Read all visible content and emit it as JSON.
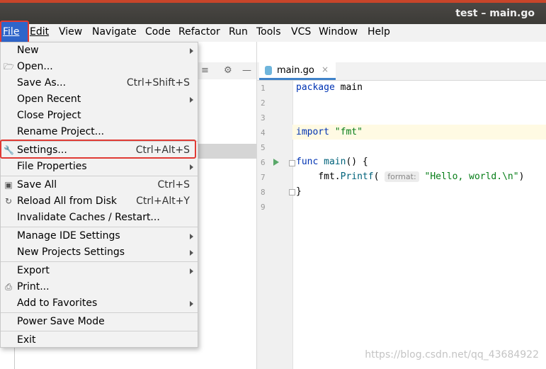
{
  "window": {
    "title": "test – main.go"
  },
  "menubar": {
    "items": [
      "File",
      "Edit",
      "View",
      "Navigate",
      "Code",
      "Refactor",
      "Run",
      "Tools",
      "VCS",
      "Window",
      "Help"
    ]
  },
  "file_menu": {
    "items": [
      {
        "label": "New",
        "shortcut": "",
        "submenu": true,
        "icon": ""
      },
      {
        "label": "Open...",
        "shortcut": "",
        "submenu": false,
        "icon": "folder-icon"
      },
      {
        "label": "Save As...",
        "shortcut": "Ctrl+Shift+S",
        "submenu": false,
        "icon": ""
      },
      {
        "label": "Open Recent",
        "shortcut": "",
        "submenu": true,
        "icon": ""
      },
      {
        "label": "Close Project",
        "shortcut": "",
        "submenu": false,
        "icon": ""
      },
      {
        "label": "Rename Project...",
        "shortcut": "",
        "submenu": false,
        "icon": ""
      },
      {
        "label": "Settings...",
        "shortcut": "Ctrl+Alt+S",
        "submenu": false,
        "icon": "wrench-icon"
      },
      {
        "label": "File Properties",
        "shortcut": "",
        "submenu": true,
        "icon": ""
      },
      {
        "label": "Save All",
        "shortcut": "Ctrl+S",
        "submenu": false,
        "icon": "save-icon"
      },
      {
        "label": "Reload All from Disk",
        "shortcut": "Ctrl+Alt+Y",
        "submenu": false,
        "icon": "reload-icon"
      },
      {
        "label": "Invalidate Caches / Restart...",
        "shortcut": "",
        "submenu": false,
        "icon": ""
      },
      {
        "label": "Manage IDE Settings",
        "shortcut": "",
        "submenu": true,
        "icon": ""
      },
      {
        "label": "New Projects Settings",
        "shortcut": "",
        "submenu": true,
        "icon": ""
      },
      {
        "label": "Export",
        "shortcut": "",
        "submenu": true,
        "icon": ""
      },
      {
        "label": "Print...",
        "shortcut": "",
        "submenu": false,
        "icon": "print-icon"
      },
      {
        "label": "Add to Favorites",
        "shortcut": "",
        "submenu": true,
        "icon": ""
      },
      {
        "label": "Power Save Mode",
        "shortcut": "",
        "submenu": false,
        "icon": ""
      },
      {
        "label": "Exit",
        "shortcut": "",
        "submenu": false,
        "icon": ""
      }
    ]
  },
  "editor": {
    "tab": "main.go",
    "line_numbers": [
      "1",
      "2",
      "3",
      "4",
      "5",
      "6",
      "7",
      "8",
      "9"
    ],
    "code": {
      "line1_kw": "package",
      "line1_rest": " main",
      "line4_kw": "import",
      "line4_str": "\"fmt\"",
      "line6_kw": "func",
      "line6_fn": " main",
      "line6_rest": "() {",
      "line7_pre": "    fmt.",
      "line7_fn": "Printf",
      "line7_paren": "(",
      "line7_hint": "format:",
      "line7_str": "\"Hello, world.\\n\"",
      "line7_close": ")",
      "line8": "}"
    }
  },
  "watermark": "https://blog.csdn.net/qq_43684922"
}
